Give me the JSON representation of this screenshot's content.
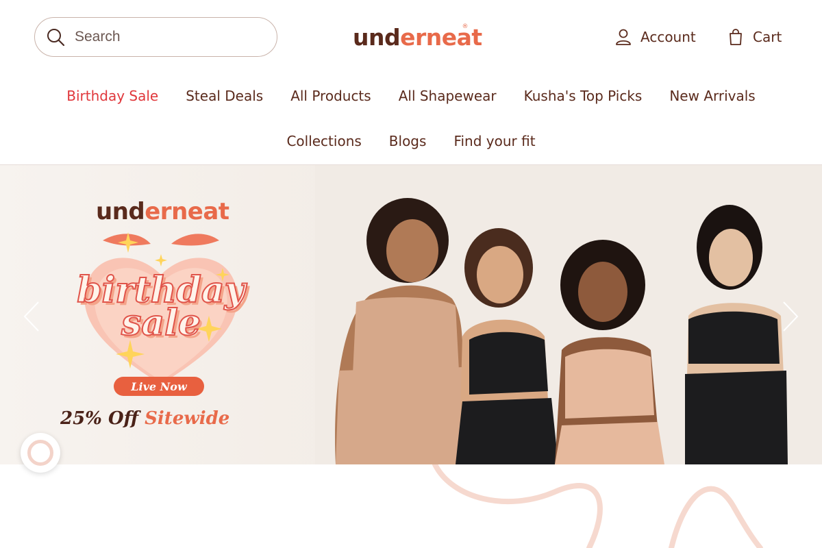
{
  "header": {
    "search_placeholder": "Search",
    "logo_part1": "und",
    "logo_part2": "erneat",
    "logo_mark": "®",
    "account_label": "Account",
    "cart_label": "Cart",
    "icons": {
      "search": "search-icon",
      "account": "user-icon",
      "cart": "shopping-bag-icon"
    }
  },
  "nav": {
    "row1": [
      {
        "label": "Birthday Sale",
        "highlight": true
      },
      {
        "label": "Steal Deals"
      },
      {
        "label": "All Products"
      },
      {
        "label": "All Shapewear"
      },
      {
        "label": "Kusha's Top Picks"
      },
      {
        "label": "New Arrivals"
      }
    ],
    "row2": [
      {
        "label": "Collections"
      },
      {
        "label": "Blogs"
      },
      {
        "label": "Find your fit"
      }
    ]
  },
  "banner": {
    "logo_part1": "und",
    "logo_part2": "erneat",
    "headline_line1": "birthday",
    "headline_line2": "sale",
    "badge": "Live Now",
    "offer_prefix": "25% Off ",
    "offer_accent": "Sitewide"
  },
  "colors": {
    "brand_dark": "#5a2a1c",
    "brand_accent": "#e86a4a",
    "sale_red": "#e0373b",
    "divider": "#e6dcd8",
    "squiggle": "#f6d9cf"
  }
}
